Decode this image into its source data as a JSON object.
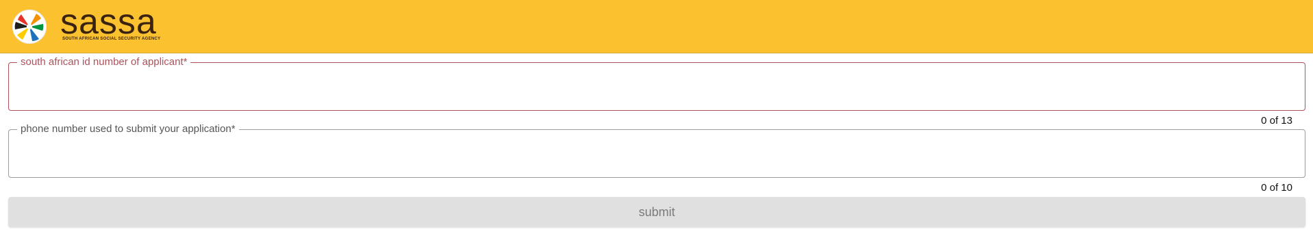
{
  "header": {
    "logo_name": "sassa",
    "logo_tagline": "SOUTH AFRICAN SOCIAL SECURITY AGENCY",
    "background_color": "#fbc12f",
    "logo_icon": "sassa-hands-circle-logo"
  },
  "form": {
    "id_field": {
      "label": "south african id number of applicant*",
      "value": "",
      "counter": "0 of 13",
      "state": "error"
    },
    "phone_field": {
      "label": "phone number used to submit your application*",
      "value": "",
      "counter": "0 of 10",
      "state": "default"
    },
    "submit_label": "submit",
    "submit_state": "disabled"
  }
}
